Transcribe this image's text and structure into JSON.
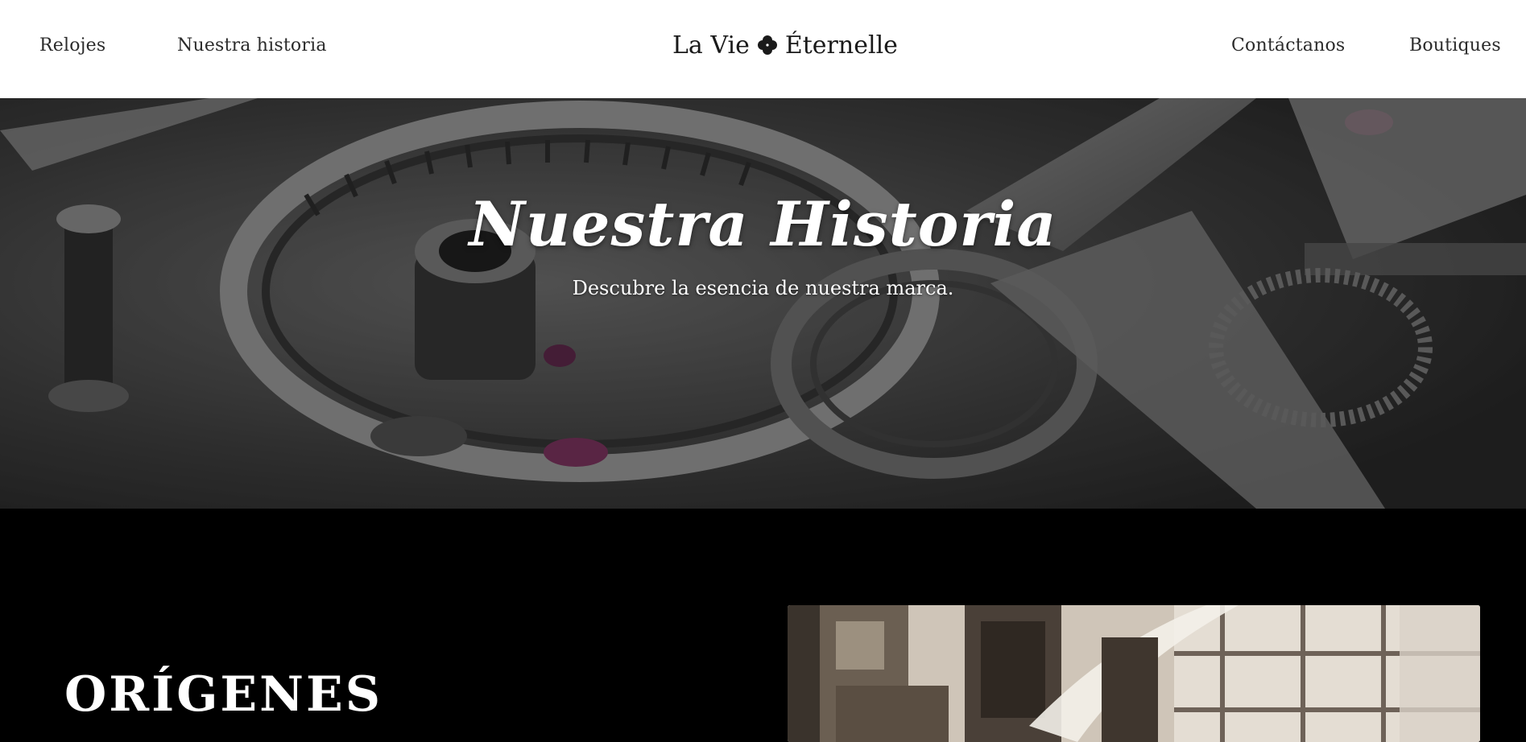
{
  "header": {
    "nav_left": [
      {
        "label": "Relojes"
      },
      {
        "label": "Nuestra historia"
      }
    ],
    "brand": {
      "text_before": "La Vie",
      "text_after": "Éternelle",
      "icon": "clover-icon"
    },
    "nav_right": [
      {
        "label": "Contáctanos"
      },
      {
        "label": "Boutiques"
      }
    ]
  },
  "hero": {
    "title": "Nuestra Historia",
    "subtitle": "Descubre la esencia de nuestra marca.",
    "background_image": "watch-movement-photo"
  },
  "origins": {
    "title": "ORÍGENES",
    "image": "vintage-workshop-photo"
  },
  "colors": {
    "header_bg": "#ffffff",
    "nav_text": "#2b2b2b",
    "section_bg": "#000000",
    "hero_text": "#ffffff"
  }
}
